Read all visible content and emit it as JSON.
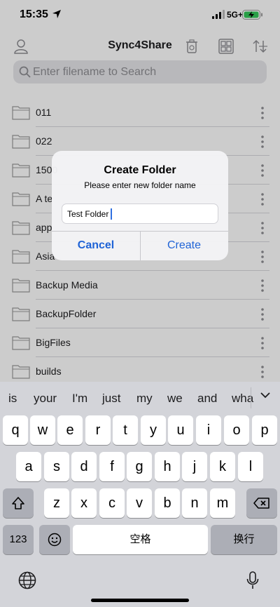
{
  "status_bar": {
    "time": "15:35",
    "network": "5G+"
  },
  "nav": {
    "title": "Sync4Share",
    "icons": [
      "person-icon",
      "trash-icon",
      "grid-icon",
      "sort-icon"
    ]
  },
  "search": {
    "placeholder": "Enter filename to Search"
  },
  "folders": [
    "011",
    "022",
    "1500",
    "A te",
    "app",
    "Asia",
    "Backup Media",
    "BackupFolder",
    "BigFiles",
    "builds"
  ],
  "dialog": {
    "title": "Create Folder",
    "message": "Please enter new folder name",
    "input_value": "Test Folder",
    "cancel_label": "Cancel",
    "create_label": "Create"
  },
  "keyboard": {
    "predictions": [
      "is",
      "your",
      "I'm",
      "just",
      "my",
      "we",
      "and",
      "wha"
    ],
    "row1": [
      "q",
      "w",
      "e",
      "r",
      "t",
      "y",
      "u",
      "i",
      "o",
      "p"
    ],
    "row2": [
      "a",
      "s",
      "d",
      "f",
      "g",
      "h",
      "j",
      "k",
      "l"
    ],
    "row3": [
      "z",
      "x",
      "c",
      "v",
      "b",
      "n",
      "m"
    ],
    "numbers_label": "123",
    "space_label": "空格",
    "return_label": "换行"
  },
  "colors": {
    "accent": "#1f63d6",
    "keyboard_bg": "#d3d4d9",
    "dim": "rgba(0,0,0,0.2)"
  }
}
